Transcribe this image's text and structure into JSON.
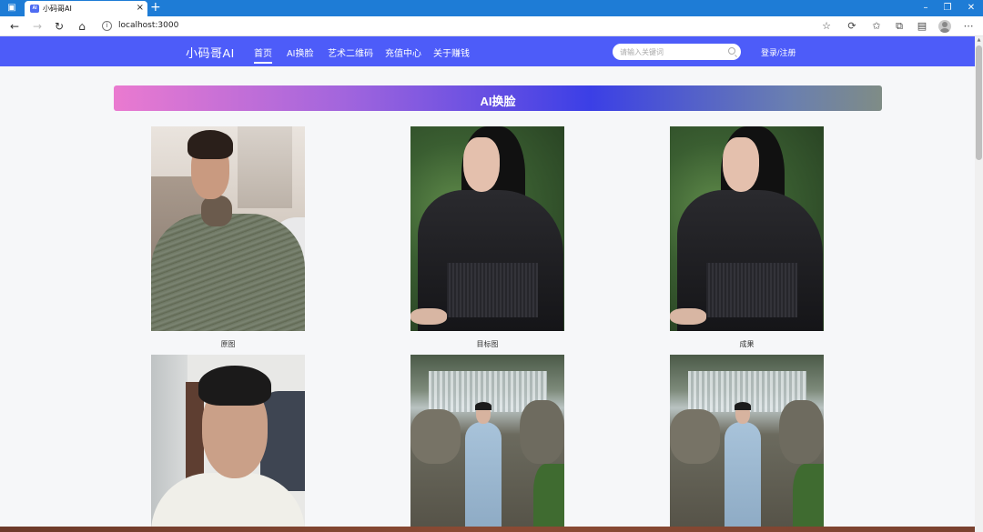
{
  "browser": {
    "tab_title": "小码哥AI",
    "favicon_text": "AI",
    "url": "localhost:3000"
  },
  "site": {
    "logo": "小码哥AI",
    "nav": [
      {
        "label": "首页",
        "active": true
      },
      {
        "label": "AI换脸",
        "active": false
      },
      {
        "label": "艺术二维码",
        "active": false
      },
      {
        "label": "充值中心",
        "active": false
      },
      {
        "label": "关于赚钱",
        "active": false
      }
    ],
    "search": {
      "placeholder": "请输入关键词",
      "value": ""
    },
    "login_label": "登录/注册",
    "accent_color": "#4d5cf9"
  },
  "banner": {
    "title": "AI换脸"
  },
  "gallery": {
    "captions": [
      "原图",
      "目标图",
      "成果"
    ]
  },
  "icons": {
    "back": "back-arrow-icon",
    "forward": "forward-arrow-icon",
    "refresh": "refresh-icon",
    "home": "home-icon",
    "info": "info-icon",
    "search": "search-icon",
    "profile": "profile-avatar-icon"
  }
}
